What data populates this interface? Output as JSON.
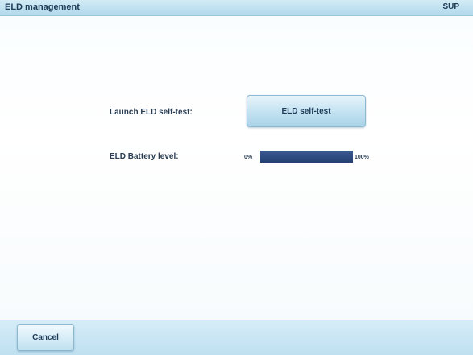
{
  "header": {
    "title": "ELD management",
    "mode": "SUP"
  },
  "selftest": {
    "label": "Launch ELD self-test:",
    "button_label": "ELD self-test"
  },
  "battery": {
    "label": "ELD Battery level:",
    "min_label": "0%",
    "max_label": "100%",
    "level_fraction": 1.0
  },
  "footer": {
    "cancel_label": "Cancel"
  },
  "colors": {
    "header_bg": "#c4e3f2",
    "accent_text": "#1d3a56",
    "battery_fill": "#2a4678"
  }
}
